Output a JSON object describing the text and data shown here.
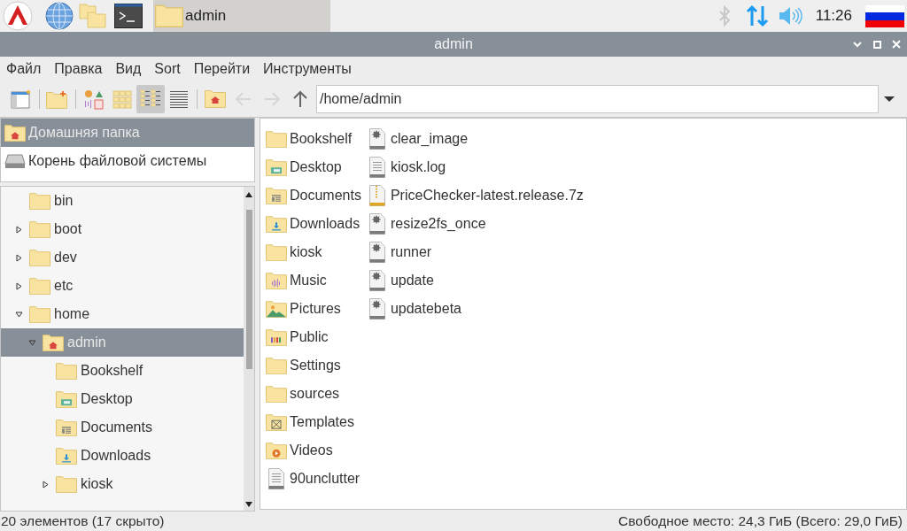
{
  "taskbar": {
    "task": {
      "label": "admin",
      "selected": true
    },
    "clock": "11:26"
  },
  "window": {
    "title": "admin"
  },
  "menu": [
    "Файл",
    "Правка",
    "Вид",
    "Sort",
    "Перейти",
    "Инструменты"
  ],
  "toolbar": {
    "buttons": [
      {
        "kind": "new-window",
        "selected": false,
        "disabled": false
      },
      {
        "kind": "new-folder",
        "selected": false,
        "disabled": false
      },
      {
        "kind": "thumbnail-view",
        "selected": false,
        "disabled": false
      },
      {
        "kind": "icon-view",
        "selected": false,
        "disabled": false
      },
      {
        "kind": "detailed-view",
        "selected": true,
        "disabled": false
      },
      {
        "kind": "compact-view",
        "selected": false,
        "disabled": false
      },
      {
        "kind": "home",
        "selected": false,
        "disabled": false
      },
      {
        "kind": "back",
        "selected": false,
        "disabled": true
      },
      {
        "kind": "forward",
        "selected": false,
        "disabled": true
      },
      {
        "kind": "up",
        "selected": false,
        "disabled": false
      }
    ],
    "path": "/home/admin"
  },
  "places": [
    {
      "label": "Домашняя папка",
      "kind": "home",
      "selected": true
    },
    {
      "label": "Корень файловой системы",
      "kind": "drive",
      "selected": false
    }
  ],
  "tree": [
    {
      "label": "bin",
      "kind": "folder",
      "has_children": false,
      "expanded": false,
      "selected": false
    },
    {
      "label": "boot",
      "kind": "folder",
      "has_children": true,
      "expanded": false,
      "selected": false
    },
    {
      "label": "dev",
      "kind": "folder",
      "has_children": true,
      "expanded": false,
      "selected": false
    },
    {
      "label": "etc",
      "kind": "folder",
      "has_children": true,
      "expanded": false,
      "selected": false
    },
    {
      "label": "home",
      "kind": "folder",
      "has_children": true,
      "expanded": true,
      "selected": false,
      "children": [
        {
          "label": "admin",
          "kind": "home",
          "has_children": true,
          "expanded": true,
          "selected": true,
          "children": [
            {
              "label": "Bookshelf",
              "kind": "folder",
              "has_children": false,
              "expanded": false,
              "selected": false
            },
            {
              "label": "Desktop",
              "kind": "desktop",
              "has_children": false,
              "expanded": false,
              "selected": false
            },
            {
              "label": "Documents",
              "kind": "documents",
              "has_children": false,
              "expanded": false,
              "selected": false
            },
            {
              "label": "Downloads",
              "kind": "downloads",
              "has_children": false,
              "expanded": false,
              "selected": false
            },
            {
              "label": "kiosk",
              "kind": "folder",
              "has_children": true,
              "expanded": false,
              "selected": false
            }
          ]
        }
      ]
    }
  ],
  "files": [
    {
      "name": "Bookshelf",
      "kind": "folder"
    },
    {
      "name": "Desktop",
      "kind": "desktop"
    },
    {
      "name": "Documents",
      "kind": "documents"
    },
    {
      "name": "Downloads",
      "kind": "downloads"
    },
    {
      "name": "kiosk",
      "kind": "folder"
    },
    {
      "name": "Music",
      "kind": "music"
    },
    {
      "name": "Pictures",
      "kind": "pictures"
    },
    {
      "name": "Public",
      "kind": "public"
    },
    {
      "name": "Settings",
      "kind": "folder"
    },
    {
      "name": "sources",
      "kind": "folder"
    },
    {
      "name": "Templates",
      "kind": "templates"
    },
    {
      "name": "Videos",
      "kind": "videos"
    },
    {
      "name": "90unclutter",
      "kind": "text"
    },
    {
      "name": "clear_image",
      "kind": "executable"
    },
    {
      "name": "kiosk.log",
      "kind": "text"
    },
    {
      "name": "PriceChecker-latest.release.7z",
      "kind": "archive"
    },
    {
      "name": "resize2fs_once",
      "kind": "executable"
    },
    {
      "name": "runner",
      "kind": "executable"
    },
    {
      "name": "update",
      "kind": "executable"
    },
    {
      "name": "updatebeta",
      "kind": "executable"
    }
  ],
  "status_bar": {
    "left": "20 элементов (17 скрыто)",
    "right": "Свободное место: 24,3 ГиБ (Всего: 29,0 ГиБ)"
  }
}
